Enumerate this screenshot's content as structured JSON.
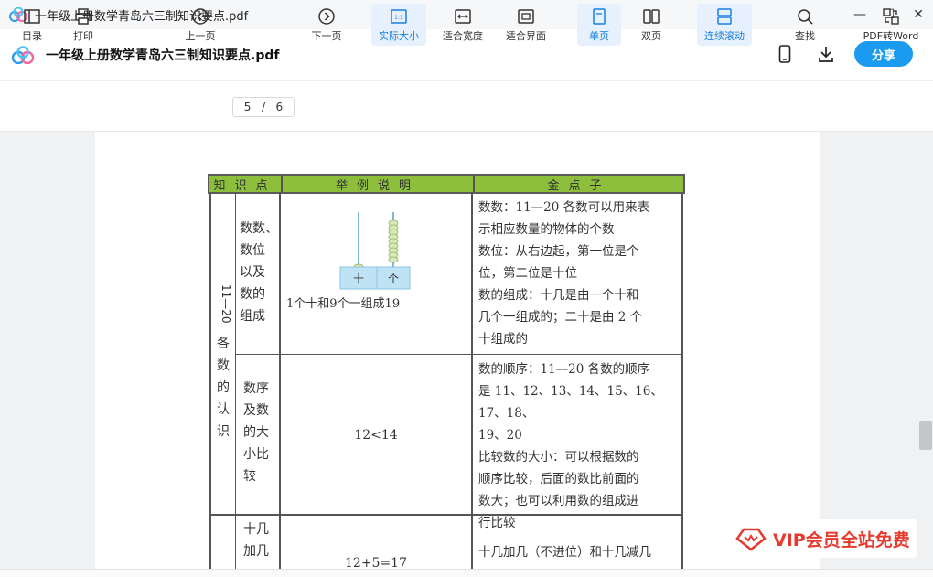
{
  "window": {
    "title": "一年级上册数学青岛六三制知识要点.pdf",
    "minimize_label": "—",
    "maximize_label": "☐",
    "close_label": "✕"
  },
  "header": {
    "title": "一年级上册数学青岛六三制知识要点.pdf",
    "share_label": "分享"
  },
  "toolbar": {
    "catalog": "目录",
    "print": "打印",
    "prev": "上一页",
    "page_current": "5",
    "page_sep": "/",
    "page_total": "6",
    "next": "下一页",
    "actual_size": "实际大小",
    "fit_width": "适合宽度",
    "fit_page": "适合界面",
    "single": "单页",
    "double": "双页",
    "continuous": "连续滚动",
    "search": "查找",
    "to_word": "PDF转Word",
    "actual_size_icon_text": "1:1"
  },
  "doc": {
    "headers": [
      "知识点",
      "举例说明",
      "金点子"
    ],
    "section": "11—20各数的认识",
    "rows": [
      {
        "point": [
          "数数、",
          "数位",
          "以及",
          "数的",
          "组成"
        ],
        "example": "1个十和9个一组成19",
        "abacus_labels": [
          "十",
          "个"
        ],
        "tips": [
          "数数：11—20 各数可以用来表",
          "示相应数量的物体的个数",
          "数位：从右边起，第一位是个",
          "位，第二位是十位",
          "数的组成：十几是由一个十和",
          "几个一组成的；二十是由 2 个",
          "十组成的"
        ]
      },
      {
        "point": [
          "数序",
          "及数",
          "的大",
          "小比",
          "较"
        ],
        "example": "12<14",
        "tips": [
          "数的顺序：11—20 各数的顺序",
          "是 11、12、13、14、15、16、17、18、",
          "19、20",
          "比较数的大小：可以根据数的",
          "顺序比较，后面的数比前面的",
          "数大；也可以利用数的组成进",
          "行比较"
        ]
      },
      {
        "point": [
          "十几",
          "加几"
        ],
        "example": "12+5=17",
        "tips": [
          "十几加几（不进位）和十几减几"
        ]
      }
    ]
  },
  "vip": {
    "text": "VIP会员全站免费"
  },
  "colors": {
    "accent": "#1a9bf0",
    "active_bg": "#e6f1fd",
    "table_header": "#8dbf3d",
    "vip_red": "#e63a2e"
  }
}
